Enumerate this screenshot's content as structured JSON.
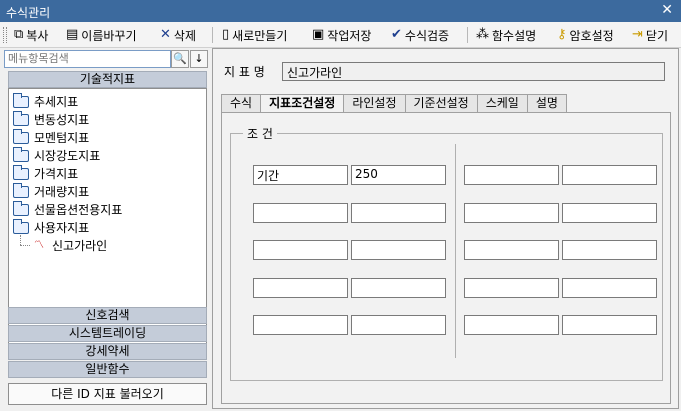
{
  "window": {
    "title": "수식관리",
    "close_glyph": "✕"
  },
  "toolbar": {
    "copy": "복사",
    "rename": "이름바꾸기",
    "delete": "삭제",
    "new": "새로만들기",
    "save": "작업저장",
    "verify": "수식검증",
    "help": "함수설명",
    "password": "암호설정",
    "close": "닫기"
  },
  "sidebar": {
    "search_placeholder": "메뉴항목검색",
    "technical_header": "기술적지표",
    "tree": [
      "추세지표",
      "변동성지표",
      "모멘텀지표",
      "시장강도지표",
      "가격지표",
      "거래량지표",
      "선물옵션전용지표",
      "사용자지표"
    ],
    "tree_leaf": "신고가라인",
    "categories": [
      "신호검색",
      "시스템트레이딩",
      "강세약세",
      "일반함수"
    ],
    "load_button": "다른 ID 지표 불러오기"
  },
  "main": {
    "name_label": "지 표 명",
    "name_value": "신고가라인",
    "tabs": [
      "수식",
      "지표조건설정",
      "라인설정",
      "기준선설정",
      "스케일",
      "설명"
    ],
    "group_title": "조 건",
    "conditions": [
      [
        "기간",
        "250",
        "",
        ""
      ],
      [
        "",
        "",
        "",
        ""
      ],
      [
        "",
        "",
        "",
        ""
      ],
      [
        "",
        "",
        "",
        ""
      ],
      [
        "",
        "",
        "",
        ""
      ]
    ]
  }
}
